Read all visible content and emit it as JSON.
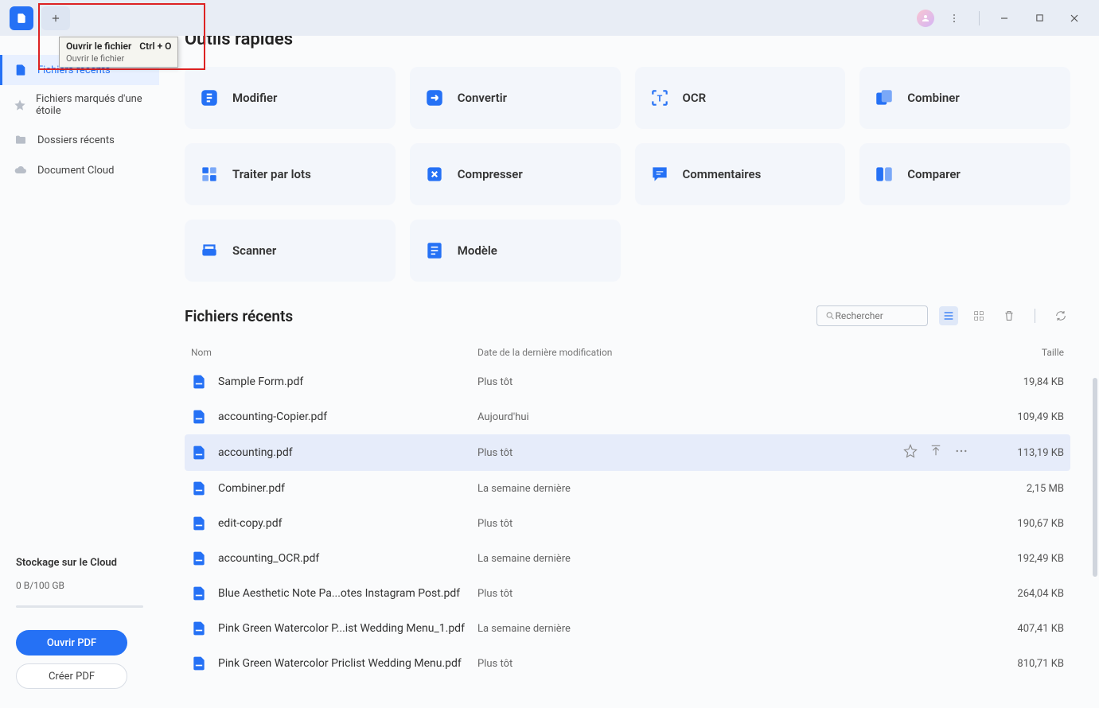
{
  "tooltip": {
    "title": "Ouvrir le fichier",
    "shortcut": "Ctrl + O",
    "sub": "Ouvrir le fichier"
  },
  "sidebar": {
    "items": [
      {
        "label": "Fichiers récents"
      },
      {
        "label": "Fichiers marqués d'une étoile"
      },
      {
        "label": "Dossiers récents"
      },
      {
        "label": "Document Cloud"
      }
    ],
    "cloud_title": "Stockage sur le Cloud",
    "cloud_usage": "0 B/100 GB",
    "open_btn": "Ouvrir PDF",
    "create_btn": "Créer PDF"
  },
  "main": {
    "section_quick": "Outils rapides",
    "tools": [
      {
        "label": "Modifier"
      },
      {
        "label": "Convertir"
      },
      {
        "label": "OCR"
      },
      {
        "label": "Combiner"
      },
      {
        "label": "Traiter par lots"
      },
      {
        "label": "Compresser"
      },
      {
        "label": "Commentaires"
      },
      {
        "label": "Comparer"
      },
      {
        "label": "Scanner"
      },
      {
        "label": "Modèle"
      }
    ],
    "recent_title": "Fichiers récents",
    "search_placeholder": "Rechercher",
    "columns": {
      "name": "Nom",
      "date": "Date de la dernière modification",
      "size": "Taille"
    },
    "files": [
      {
        "name": "Sample Form.pdf",
        "date": "Plus tôt",
        "size": "19,84 KB",
        "hover": false
      },
      {
        "name": "accounting-Copier.pdf",
        "date": "Aujourd'hui",
        "size": "109,49 KB",
        "hover": false
      },
      {
        "name": "accounting.pdf",
        "date": "Plus tôt",
        "size": "113,19 KB",
        "hover": true
      },
      {
        "name": "Combiner.pdf",
        "date": "La semaine dernière",
        "size": "2,15 MB",
        "hover": false
      },
      {
        "name": "edit-copy.pdf",
        "date": "Plus tôt",
        "size": "190,67 KB",
        "hover": false
      },
      {
        "name": "accounting_OCR.pdf",
        "date": "La semaine dernière",
        "size": "192,49 KB",
        "hover": false
      },
      {
        "name": "Blue Aesthetic Note Pa...otes Instagram Post.pdf",
        "date": "Plus tôt",
        "size": "264,04 KB",
        "hover": false
      },
      {
        "name": "Pink Green Watercolor P...ist Wedding Menu_1.pdf",
        "date": "La semaine dernière",
        "size": "407,41 KB",
        "hover": false
      },
      {
        "name": "Pink Green Watercolor Priclist Wedding Menu.pdf",
        "date": "Plus tôt",
        "size": "810,71 KB",
        "hover": false
      }
    ]
  }
}
